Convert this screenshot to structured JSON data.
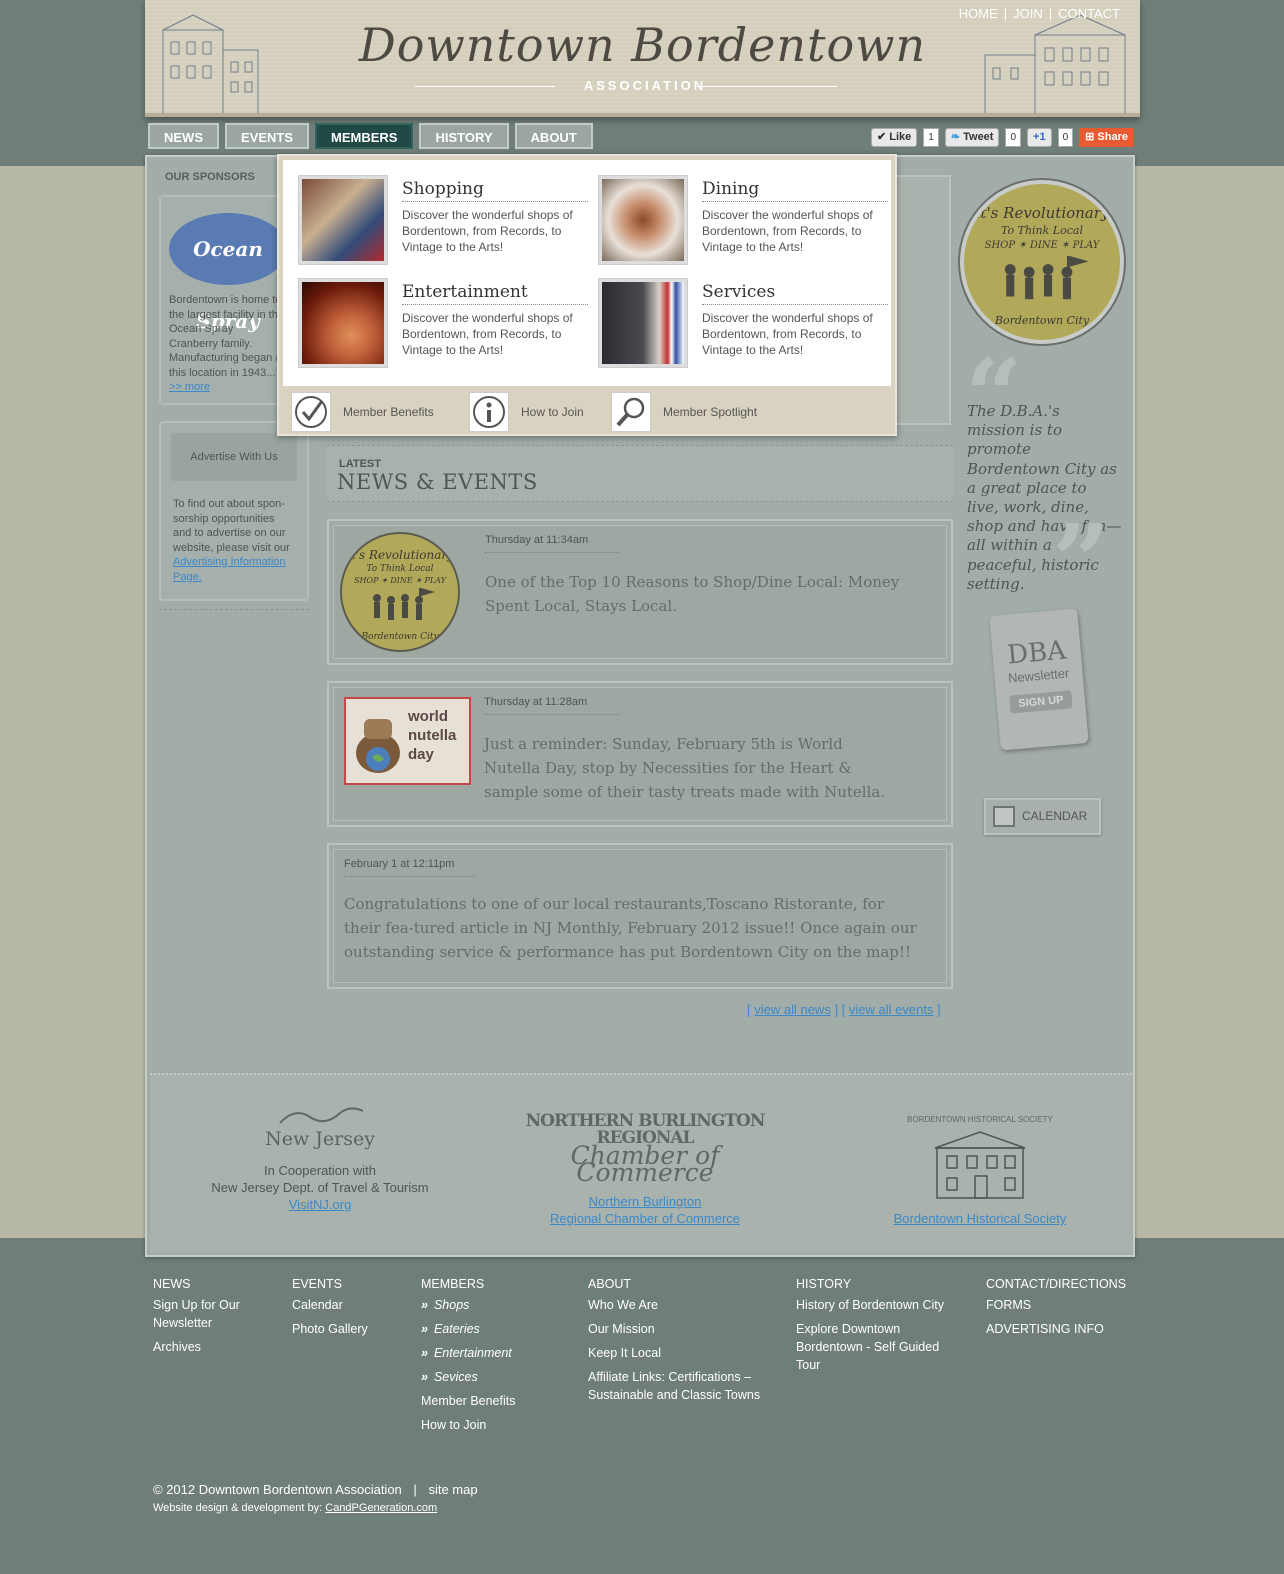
{
  "header": {
    "title": "Downtown Bordentown",
    "subtitle": "ASSOCIATION",
    "top_links": [
      "HOME",
      "JOIN",
      "CONTACT"
    ]
  },
  "nav": {
    "tabs": [
      {
        "label": "NEWS",
        "active": false
      },
      {
        "label": "EVENTS",
        "active": false
      },
      {
        "label": "MEMBERS",
        "active": true
      },
      {
        "label": "HISTORY",
        "active": false
      },
      {
        "label": "ABOUT",
        "active": false
      }
    ]
  },
  "social": {
    "like_label": "Like",
    "like_count": "1",
    "tweet_label": "Tweet",
    "tweet_count": "0",
    "plusone_label": "+1",
    "plusone_count": "0",
    "share_label": "Share"
  },
  "sidebar": {
    "heading": "OUR SPONSORS",
    "sponsor_logo": "Ocean Spray",
    "sponsor_text": "Bordentown is home to the largest facility in the Ocean Spray Cranberry family. Manufacturing began at this location in 1943...",
    "sponsor_more": ">> more",
    "advertise_button": "Advertise With Us",
    "advertise_text": "To find out about spon-sorship opportunities and to advertise on our website, please visit our",
    "advertise_link": "Advertising Information Page."
  },
  "dropdown": {
    "items": [
      {
        "title": "Shopping",
        "desc": "Discover the wonderful shops of Bordentown, from Records, to Vintage to the Arts!"
      },
      {
        "title": "Dining",
        "desc": "Discover the wonderful shops of Bordentown, from Records, to Vintage to the Arts!"
      },
      {
        "title": "Entertainment",
        "desc": "Discover the wonderful shops of Bordentown, from Records, to Vintage to the Arts!"
      },
      {
        "title": "Services",
        "desc": "Discover the wonderful shops of Bordentown, from Records, to Vintage to the Arts!"
      }
    ],
    "footer": [
      "Member Benefits",
      "How to Join",
      "Member Spotlight"
    ]
  },
  "news": {
    "latest_label": "LATEST",
    "title": "NEWS & EVENTS",
    "items": [
      {
        "date": "Thursday at 11:34am",
        "text": "One of the Top 10 Reasons to Shop/Dine Local: Money Spent Local, Stays Local."
      },
      {
        "date": "Thursday at 11:28am",
        "text": "Just a reminder: Sunday, February 5th is World Nutella Day, stop by Necessities for the Heart & sample some of their tasty treats made with Nutella."
      },
      {
        "date": "February 1 at 12:11pm",
        "text": "Congratulations to one of our local restaurants,Toscano Ristorante, for their fea-tured article in NJ Monthly, February 2012 issue!! Once again our outstanding service & performance has put Bordentown City on the map!!"
      }
    ],
    "nutella_text": "world nutella day",
    "view_all_news": "view all news",
    "view_all_events": "view all events"
  },
  "right": {
    "badge_top": "It's Revolutionary",
    "badge_mid": "To Think Local",
    "badge_sub": "SHOP ✶ DINE ✶ PLAY",
    "badge_bottom": "Bordentown City",
    "mission": "The D.B.A.'s mission is to promote Bordentown City as a great place to live, work, dine, shop and have fun—all within a peaceful, historic setting.",
    "newsletter_dba": "DBA",
    "newsletter_label": "Newsletter",
    "newsletter_signup": "SIGN UP",
    "calendar_label": "CALENDAR"
  },
  "partners": {
    "nj_logo": "New Jersey",
    "nj_line1": "In Cooperation with",
    "nj_line2": "New Jersey Dept. of Travel & Tourism",
    "nj_link": "VisitNJ.org",
    "chamber_logo_top": "NORTHERN BURLINGTON REGIONAL",
    "chamber_logo_bottom": "Chamber of Commerce",
    "chamber_link1": "Northern Burlington",
    "chamber_link2": "Regional Chamber of Commerce",
    "hist_logo": "BORDENTOWN HISTORICAL SOCIETY",
    "hist_link": "Bordentown Historical Society"
  },
  "footer": {
    "news": {
      "head": "NEWS",
      "items": [
        "Sign Up for Our Newsletter",
        "Archives"
      ]
    },
    "events": {
      "head": "EVENTS",
      "items": [
        "Calendar",
        "Photo Gallery"
      ]
    },
    "members": {
      "head": "MEMBERS",
      "items": [
        "Shops",
        "Eateries",
        "Entertainment",
        "Sevices"
      ],
      "plain": [
        "Member Benefits",
        "How to Join"
      ]
    },
    "about": {
      "head": "ABOUT",
      "items": [
        "Who We Are",
        "Our Mission",
        "Keep It Local",
        "Affiliate Links: Certifications – Sustainable and Classic Towns"
      ]
    },
    "history": {
      "head": "HISTORY",
      "items": [
        "History of Bordentown City",
        "Explore Downtown Bordentown - Self Guided Tour"
      ]
    },
    "contact": {
      "head": "CONTACT/DIRECTIONS",
      "items": [
        "FORMS",
        "ADVERTISING INFO"
      ]
    },
    "copyright": "© 2012 Downtown Bordentown Association",
    "sitemap": "site map",
    "credits_label": "Website design & development by:",
    "credits_link": "CandPGeneration.com"
  }
}
